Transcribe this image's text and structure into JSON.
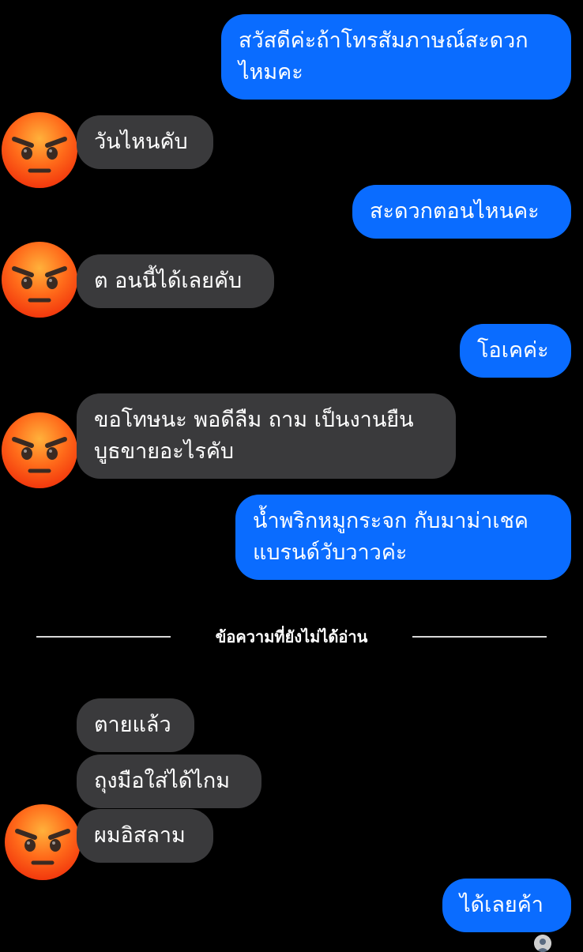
{
  "colors": {
    "background": "#000000",
    "outgoing_bubble": "#0a6cff",
    "incoming_bubble": "#3a3a3c",
    "text": "#ffffff",
    "divider": "#d8d8d8"
  },
  "icons": {
    "contact_avatar": "angry-face-emoji-icon",
    "seen_indicator": "seen-avatar-icon"
  },
  "messages": [
    {
      "direction": "outgoing",
      "lines": [
        "สวัสดีค่ะถ้าโทรสัมภาษณ์สะดวก",
        "ไหมคะ"
      ]
    },
    {
      "direction": "incoming",
      "lines": [
        "วันไหนคับ"
      ]
    },
    {
      "direction": "outgoing",
      "lines": [
        "สะดวกตอนไหนคะ"
      ]
    },
    {
      "direction": "incoming",
      "lines": [
        "ต อนนี้ได้เลยคับ"
      ]
    },
    {
      "direction": "outgoing",
      "lines": [
        "โอเคค่ะ"
      ]
    },
    {
      "direction": "incoming",
      "lines": [
        "ขอโทษนะ พอดีลืม ถาม เป็นงานยืน",
        "บูธขายอะไรคับ"
      ]
    },
    {
      "direction": "outgoing",
      "lines": [
        "น้ำพริกหมูกระจก กับมาม่าเชค",
        "แบรนด์วับวาวค่ะ"
      ]
    },
    {
      "direction": "incoming",
      "lines": [
        "ตายแล้ว"
      ]
    },
    {
      "direction": "incoming",
      "lines": [
        "ถุงมือใส่ได้ไกม"
      ]
    },
    {
      "direction": "incoming",
      "lines": [
        "ผมอิสลาม"
      ]
    },
    {
      "direction": "outgoing",
      "lines": [
        "ได้เลยค้า"
      ]
    }
  ],
  "unread_divider": {
    "label": "ข้อความที่ยังไม่ได้อ่าน"
  }
}
